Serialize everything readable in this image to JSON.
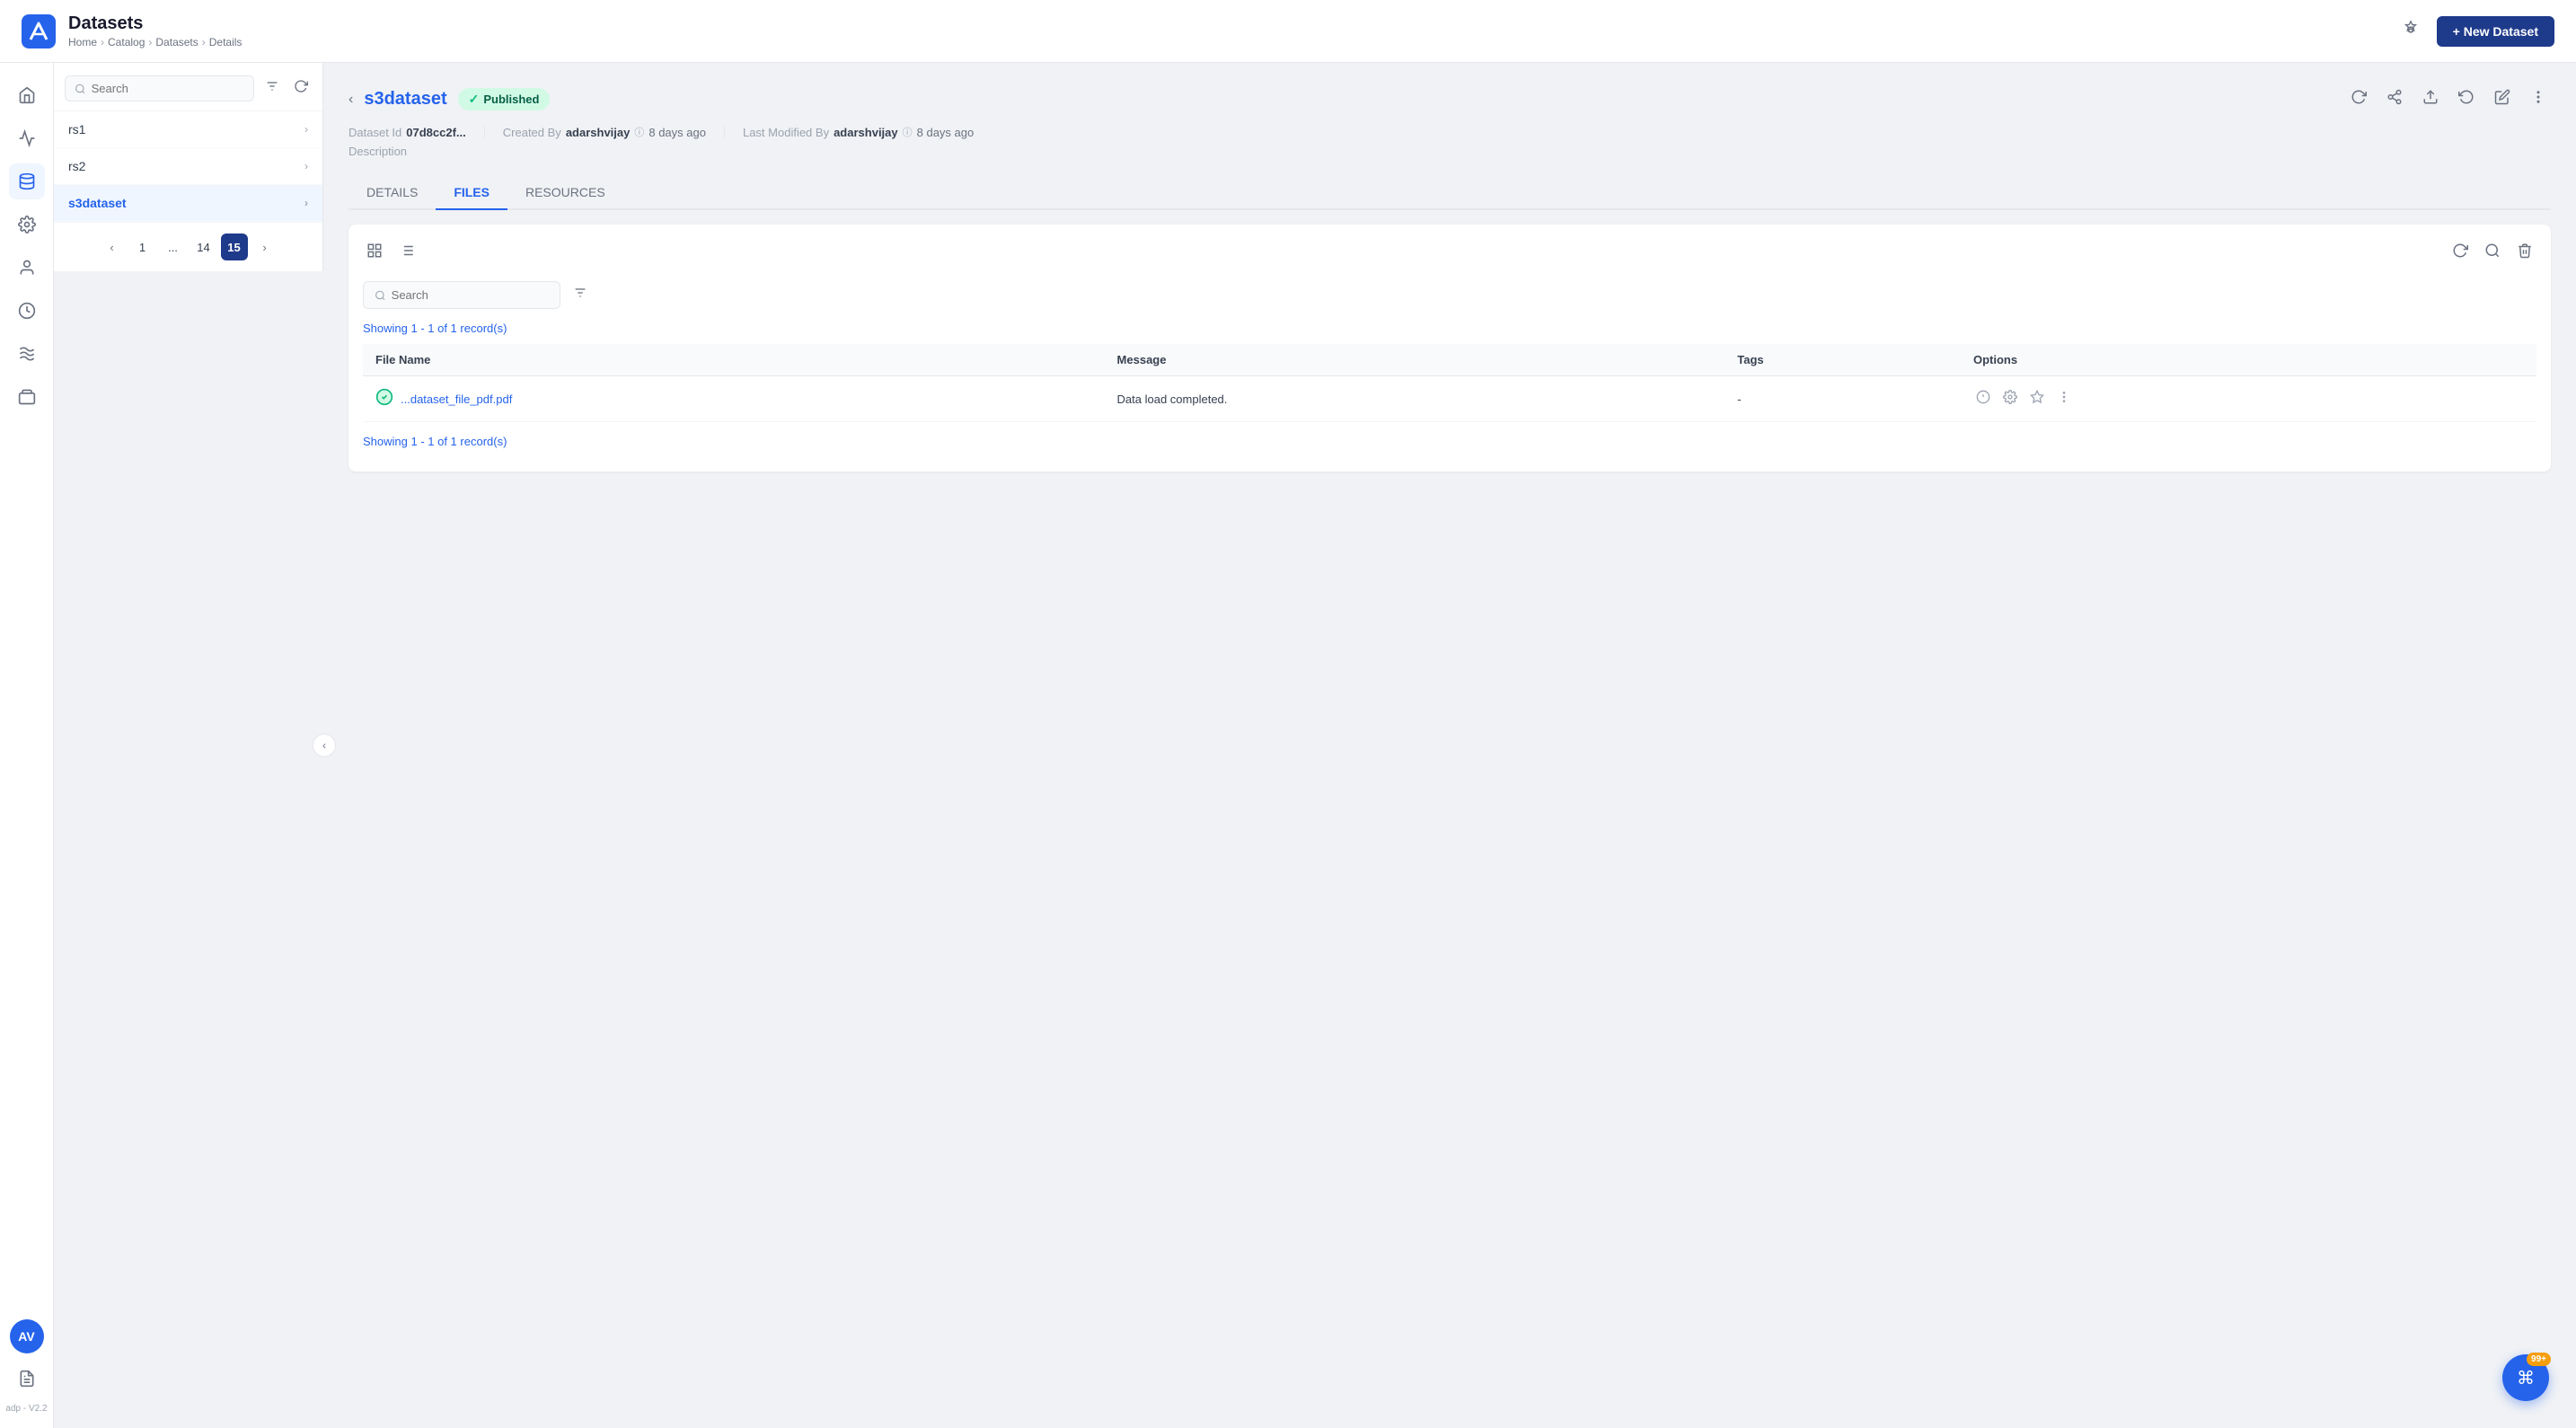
{
  "app": {
    "version": "adp - V2.2",
    "title": "Datasets",
    "new_dataset_label": "+ New Dataset"
  },
  "breadcrumb": {
    "items": [
      "Home",
      "Catalog",
      "Datasets",
      "Details"
    ],
    "separators": [
      ">",
      ">",
      ">"
    ]
  },
  "sidebar": {
    "search_placeholder": "Search",
    "items": [
      {
        "label": "rs1",
        "active": false
      },
      {
        "label": "rs2",
        "active": false
      },
      {
        "label": "s3dataset",
        "active": true
      }
    ],
    "pagination": {
      "prev_label": "‹",
      "next_label": "›",
      "pages": [
        "1",
        "...",
        "14",
        "15"
      ],
      "active_page": "15"
    }
  },
  "dataset": {
    "back_label": "‹",
    "name": "s3dataset",
    "status": "Published",
    "status_check": "✓",
    "dataset_id_label": "Dataset Id",
    "dataset_id_value": "07d8cc2f...",
    "created_by_label": "Created By",
    "created_by_value": "adarshvijay",
    "created_ago": "8 days ago",
    "modified_by_label": "Last Modified By",
    "modified_by_value": "adarshvijay",
    "modified_ago": "8 days ago",
    "description_label": "Description"
  },
  "tabs": [
    {
      "label": "DETAILS",
      "active": false,
      "key": "details"
    },
    {
      "label": "FILES",
      "active": true,
      "key": "files"
    },
    {
      "label": "RESOURCES",
      "active": false,
      "key": "resources"
    }
  ],
  "files": {
    "search_placeholder": "Search",
    "records_count": "Showing 1 - 1 of 1 record(s)",
    "records_count_bottom": "Showing 1 - 1 of 1 record(s)",
    "table": {
      "columns": [
        "File Name",
        "Message",
        "Tags",
        "Options"
      ],
      "rows": [
        {
          "file_name": "...dataset_file_pdf.pdf",
          "message": "Data load completed.",
          "tags": "-",
          "status": "success"
        }
      ]
    }
  },
  "notification": {
    "count": "99+",
    "icon": "⌘"
  },
  "nav_icons": [
    {
      "name": "home-icon",
      "glyph": "⌂"
    },
    {
      "name": "analytics-icon",
      "glyph": "⚡"
    },
    {
      "name": "data-icon",
      "glyph": "◉"
    },
    {
      "name": "settings-icon",
      "glyph": "⚙"
    },
    {
      "name": "user-icon",
      "glyph": "👤"
    },
    {
      "name": "clock-icon",
      "glyph": "◷"
    },
    {
      "name": "layers-icon",
      "glyph": "≋"
    },
    {
      "name": "box-icon",
      "glyph": "▣"
    }
  ],
  "avatar": {
    "initials": "AV",
    "bg_color": "#2563eb"
  },
  "header_action_icons": [
    {
      "name": "refresh-icon",
      "glyph": "↻"
    },
    {
      "name": "share-icon",
      "glyph": "↗"
    },
    {
      "name": "upload-icon",
      "glyph": "↑"
    },
    {
      "name": "history-icon",
      "glyph": "⟳"
    },
    {
      "name": "edit-icon",
      "glyph": "✎"
    },
    {
      "name": "more-icon",
      "glyph": "⋮"
    }
  ]
}
